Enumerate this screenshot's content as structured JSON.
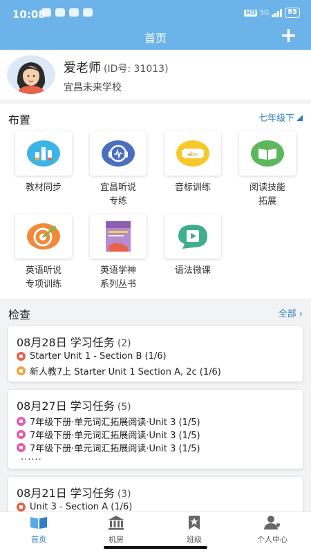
{
  "status_bar": {
    "time": "10:08",
    "network_tag": "HD",
    "signal": "5G",
    "battery": "85"
  },
  "header": {
    "title": "首页",
    "add_label": "+"
  },
  "profile": {
    "name": "爱老师",
    "id_text": "(ID号: 31013)",
    "school": "宜昌未来学校"
  },
  "arrange": {
    "title": "布置",
    "grade": "七年级下",
    "tiles": [
      {
        "label_line1": "教材同步",
        "label_line2": "",
        "icon": "bar-chart-icon"
      },
      {
        "label_line1": "宜昌听说",
        "label_line2": "专练",
        "icon": "headset-icon"
      },
      {
        "label_line1": "音标训练",
        "label_line2": "",
        "icon": "abc-icon"
      },
      {
        "label_line1": "阅读技能",
        "label_line2": "拓展",
        "icon": "book-icon"
      },
      {
        "label_line1": "英语听说",
        "label_line2": "专项训练",
        "icon": "target-icon"
      },
      {
        "label_line1": "英语学神",
        "label_line2": "系列丛书",
        "icon": "book-cover-icon"
      },
      {
        "label_line1": "语法微课",
        "label_line2": "",
        "icon": "video-chat-icon"
      }
    ]
  },
  "check": {
    "title": "检查",
    "all_label": "全部 ›",
    "cards": [
      {
        "date": "08月28日 学习任务",
        "count": "(2)",
        "items": [
          {
            "text": "Starter Unit 1  - Section B (1/6)",
            "color": "red"
          },
          {
            "text": "新人教7上 Starter Unit 1 Section A, 2c (1/6)",
            "color": "orange"
          }
        ]
      },
      {
        "date": "08月27日 学习任务",
        "count": "(5)",
        "items": [
          {
            "text": "7年级下册·单元词汇拓展阅读·Unit 3 (1/5)",
            "color": "pink"
          },
          {
            "text": "7年级下册·单元词汇拓展阅读·Unit 3 (1/5)",
            "color": "pink"
          },
          {
            "text": "7年级下册·单元词汇拓展阅读·Unit 3 (1/5)",
            "color": "pink"
          }
        ],
        "more": "......"
      },
      {
        "date": "08月21日 学习任务",
        "count": "(3)",
        "items": [
          {
            "text": "Unit 3  - Section A (1/6)",
            "color": "red"
          }
        ]
      }
    ]
  },
  "tabbar": {
    "tabs": [
      {
        "label": "首页",
        "icon": "open-book-icon"
      },
      {
        "label": "机房",
        "icon": "building-icon"
      },
      {
        "label": "班级",
        "icon": "star-bookmark-icon"
      },
      {
        "label": "个人中心",
        "icon": "person-heart-icon"
      }
    ]
  },
  "colors": {
    "header": "#6cb3ea",
    "accent": "#2e7ec8",
    "red": "#e8634a",
    "orange": "#f2a33a",
    "pink": "#e55aa8"
  }
}
